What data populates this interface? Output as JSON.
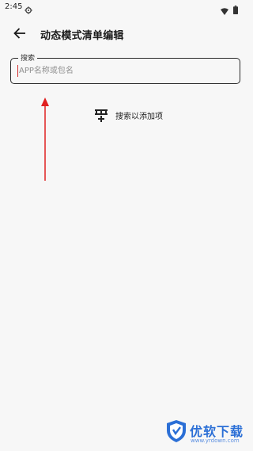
{
  "status_bar": {
    "time": "2:45",
    "icons": [
      "gear-icon",
      "wifi-icon",
      "battery-icon"
    ]
  },
  "app_bar": {
    "back_icon": "arrow-left-icon",
    "title": "动态模式清单编辑"
  },
  "search": {
    "label": "搜索",
    "placeholder": "APP名称或包名",
    "value": ""
  },
  "hint": {
    "icon": "add-list-icon",
    "text": "搜索以添加项"
  },
  "watermark": {
    "title": "优软下载",
    "url": "www.yrdown.com"
  },
  "colors": {
    "background": "#f7f7f7",
    "annotation_arrow": "#e02020",
    "watermark_blue": "#2b6fd6"
  }
}
